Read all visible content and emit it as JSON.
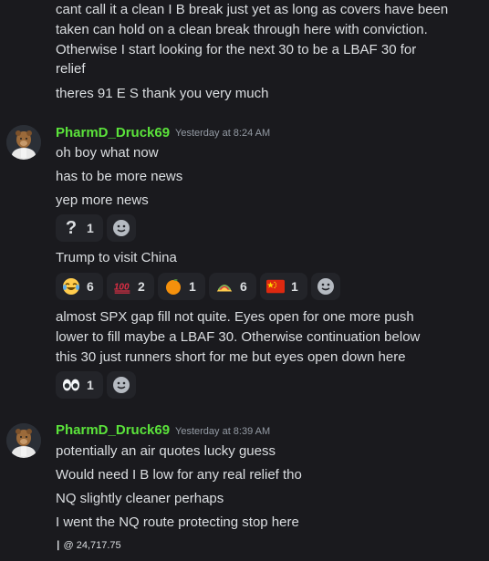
{
  "messages": [
    {
      "lines": [
        "cant call it a clean I B break just yet as long as covers have been",
        "taken can hold on a clean break through here with conviction.",
        "Otherwise I start looking for the next 30 to be a LBAF 30 for",
        "relief",
        "theres 91 E S thank you very much"
      ]
    },
    {
      "username": "PharmD_Druck69",
      "timestamp": "Yesterday at 8:24 AM",
      "lines": [
        "oh boy what now",
        "has to be more news",
        "yep more news"
      ],
      "reactions": [
        {
          "emoji": "question-icon",
          "count": "1"
        }
      ],
      "line2": "Trump to visit China",
      "reactions2": [
        {
          "emoji": "joy-emoji",
          "count": "6"
        },
        {
          "emoji": "hundred-emoji",
          "count": "2"
        },
        {
          "emoji": "orange-emoji",
          "count": "1"
        },
        {
          "emoji": "taco-emoji",
          "count": "6"
        },
        {
          "emoji": "china-flag-emoji",
          "count": "1"
        }
      ],
      "lines3": [
        "almost SPX gap fill not quite. Eyes open for one more push",
        "lower to fill maybe a LBAF 30. Otherwise continuation below",
        "this 30 just runners short for me but eyes open down here"
      ],
      "reactions3": [
        {
          "emoji": "eyes-emoji",
          "count": "1"
        }
      ]
    },
    {
      "username": "PharmD_Druck69",
      "timestamp": "Yesterday at 8:39 AM",
      "lines": [
        "potentially an air quotes lucky guess",
        "Would need I B low for any real relief tho",
        "NQ slightly cleaner perhaps",
        "I went the NQ route protecting stop here"
      ],
      "fill": "@ 24,717.75"
    }
  ],
  "colors": {
    "background": "#1a1a1e",
    "username": "#5be33b",
    "text": "#dbdee1",
    "timestamp": "#949ba4",
    "reaction_bg": "#232429"
  }
}
